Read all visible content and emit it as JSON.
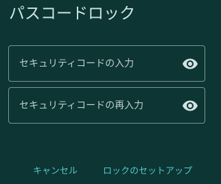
{
  "dialog": {
    "title": "パスコードロック"
  },
  "fields": [
    {
      "placeholder": "セキュリティコードの入力",
      "value": "",
      "icon": "eye-icon"
    },
    {
      "placeholder": "セキュリティコードの再入力",
      "value": "",
      "icon": "eye-icon"
    }
  ],
  "actions": {
    "cancel_label": "キャンセル",
    "setup_label": "ロックのセットアップ"
  },
  "colors": {
    "background": "#0c3533",
    "accent": "#56c7ce",
    "text": "#cfe6e2",
    "border": "#7d9794"
  }
}
